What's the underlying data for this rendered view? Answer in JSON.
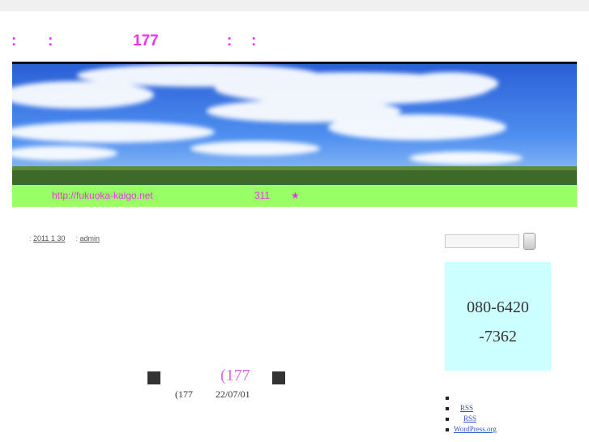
{
  "site": {
    "title_parts": [
      ":",
      ":",
      "177",
      ":",
      ":"
    ]
  },
  "banner": {
    "url_text": "http://fukuoka-kaigo.net",
    "number_text": "311",
    "star": "★"
  },
  "post": {
    "date": "2011 1 30",
    "author": "admin",
    "heading": "(177",
    "sub_left": "(177",
    "sub_right": "22/07/01"
  },
  "sidebar": {
    "search_placeholder": "",
    "phone_line1": "080-6420",
    "phone_line2": "-7362",
    "links": [
      "",
      "RSS",
      "RSS",
      "WordPress.org"
    ]
  },
  "colors": {
    "title_accent": "#ee33ee",
    "green_bar": "#99ff66",
    "phone_box": "#ccffff",
    "heading_pink": "#dd66dd"
  }
}
